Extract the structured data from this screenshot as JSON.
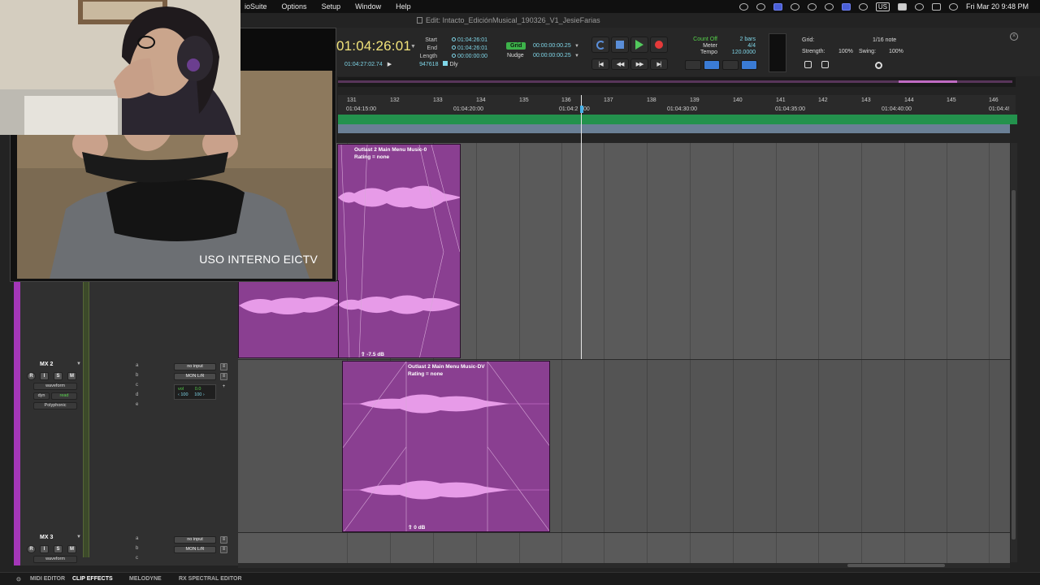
{
  "menubar": {
    "items": [
      "ioSuite",
      "Options",
      "Setup",
      "Window",
      "Help"
    ],
    "clock": "Fri Mar 20  9:48 PM",
    "input_badge": "US"
  },
  "window": {
    "title": "Edit: Intacto_EdiciónMusical_190326_V1_JesieFarias"
  },
  "counter": {
    "main": "01:04:26:01",
    "labels": [
      "Start",
      "End",
      "Length"
    ],
    "start": "01:04:26:01",
    "end": "01:04:26:01",
    "length": "00:00:00:00",
    "position": "01:04:27:02.74",
    "samples": "947618",
    "dly_label": "Dly"
  },
  "grid_nudge": {
    "grid_label": "Grid",
    "grid_value": "00:00:00:00.25",
    "nudge_label": "Nudge",
    "nudge_value": "00:00:00:00.25"
  },
  "countoff": {
    "labels": [
      "Count Off",
      "Meter",
      "Tempo"
    ],
    "values": [
      "2 bars",
      "4/4",
      "120.0000"
    ]
  },
  "grid_panel": {
    "grid_label": "Grid:",
    "grid_value": "1/16 note",
    "strength_label": "Strength:",
    "strength_value": "100%",
    "swing_label": "Swing:",
    "swing_value": "100%"
  },
  "ruler": {
    "bars": [
      "131",
      "132",
      "133",
      "134",
      "135",
      "136",
      "137",
      "138",
      "139",
      "140",
      "141",
      "142",
      "143",
      "144",
      "145",
      "146"
    ],
    "timecode": [
      "01:04:15:00",
      "01:04:20:00",
      "01:04:2",
      "00",
      "01:04:30:00",
      "01:04:35:00",
      "01:04:40:00",
      "01:04:4!"
    ]
  },
  "tracks": {
    "clip1": {
      "name": "Outlast 2 Main Menu Music-0",
      "rating": "Rating = none",
      "gain": "-7.5 dB"
    },
    "clip2": {
      "name": "Outlast 2 Main Menu Music-DV",
      "rating": "Rating = none",
      "gain": "0 dB"
    },
    "mx2": {
      "name": "MX 2",
      "buttons": [
        "R",
        "I",
        "S",
        "M"
      ],
      "view": "waveform",
      "dyn": "dyn",
      "dyn_state": "read",
      "algo": "Polyphonic",
      "inserts": [
        "a",
        "b",
        "c",
        "d",
        "e"
      ],
      "input": "no input",
      "output": "MON L/R",
      "vol_label": "vol",
      "vol_value": "0.0",
      "pan_l": "‹ 100",
      "pan_r": "100 ›"
    },
    "mx3": {
      "name": "MX 3",
      "buttons": [
        "R",
        "I",
        "S",
        "M"
      ],
      "view": "waveform",
      "inserts": [
        "a",
        "b",
        "c"
      ],
      "input": "no input",
      "output": "MON L/R"
    }
  },
  "video": {
    "caption": "USO INTERNO EICTV"
  },
  "bottom_tabs": [
    "MIDI EDITOR",
    "CLIP EFFECTS",
    "MELODYNE",
    "RX SPECTRAL EDITOR"
  ],
  "colors": {
    "clip": "#8a3f91",
    "waveform": "#e79be8",
    "accent_green": "#23924d",
    "counter_yellow": "#f1e27a"
  }
}
